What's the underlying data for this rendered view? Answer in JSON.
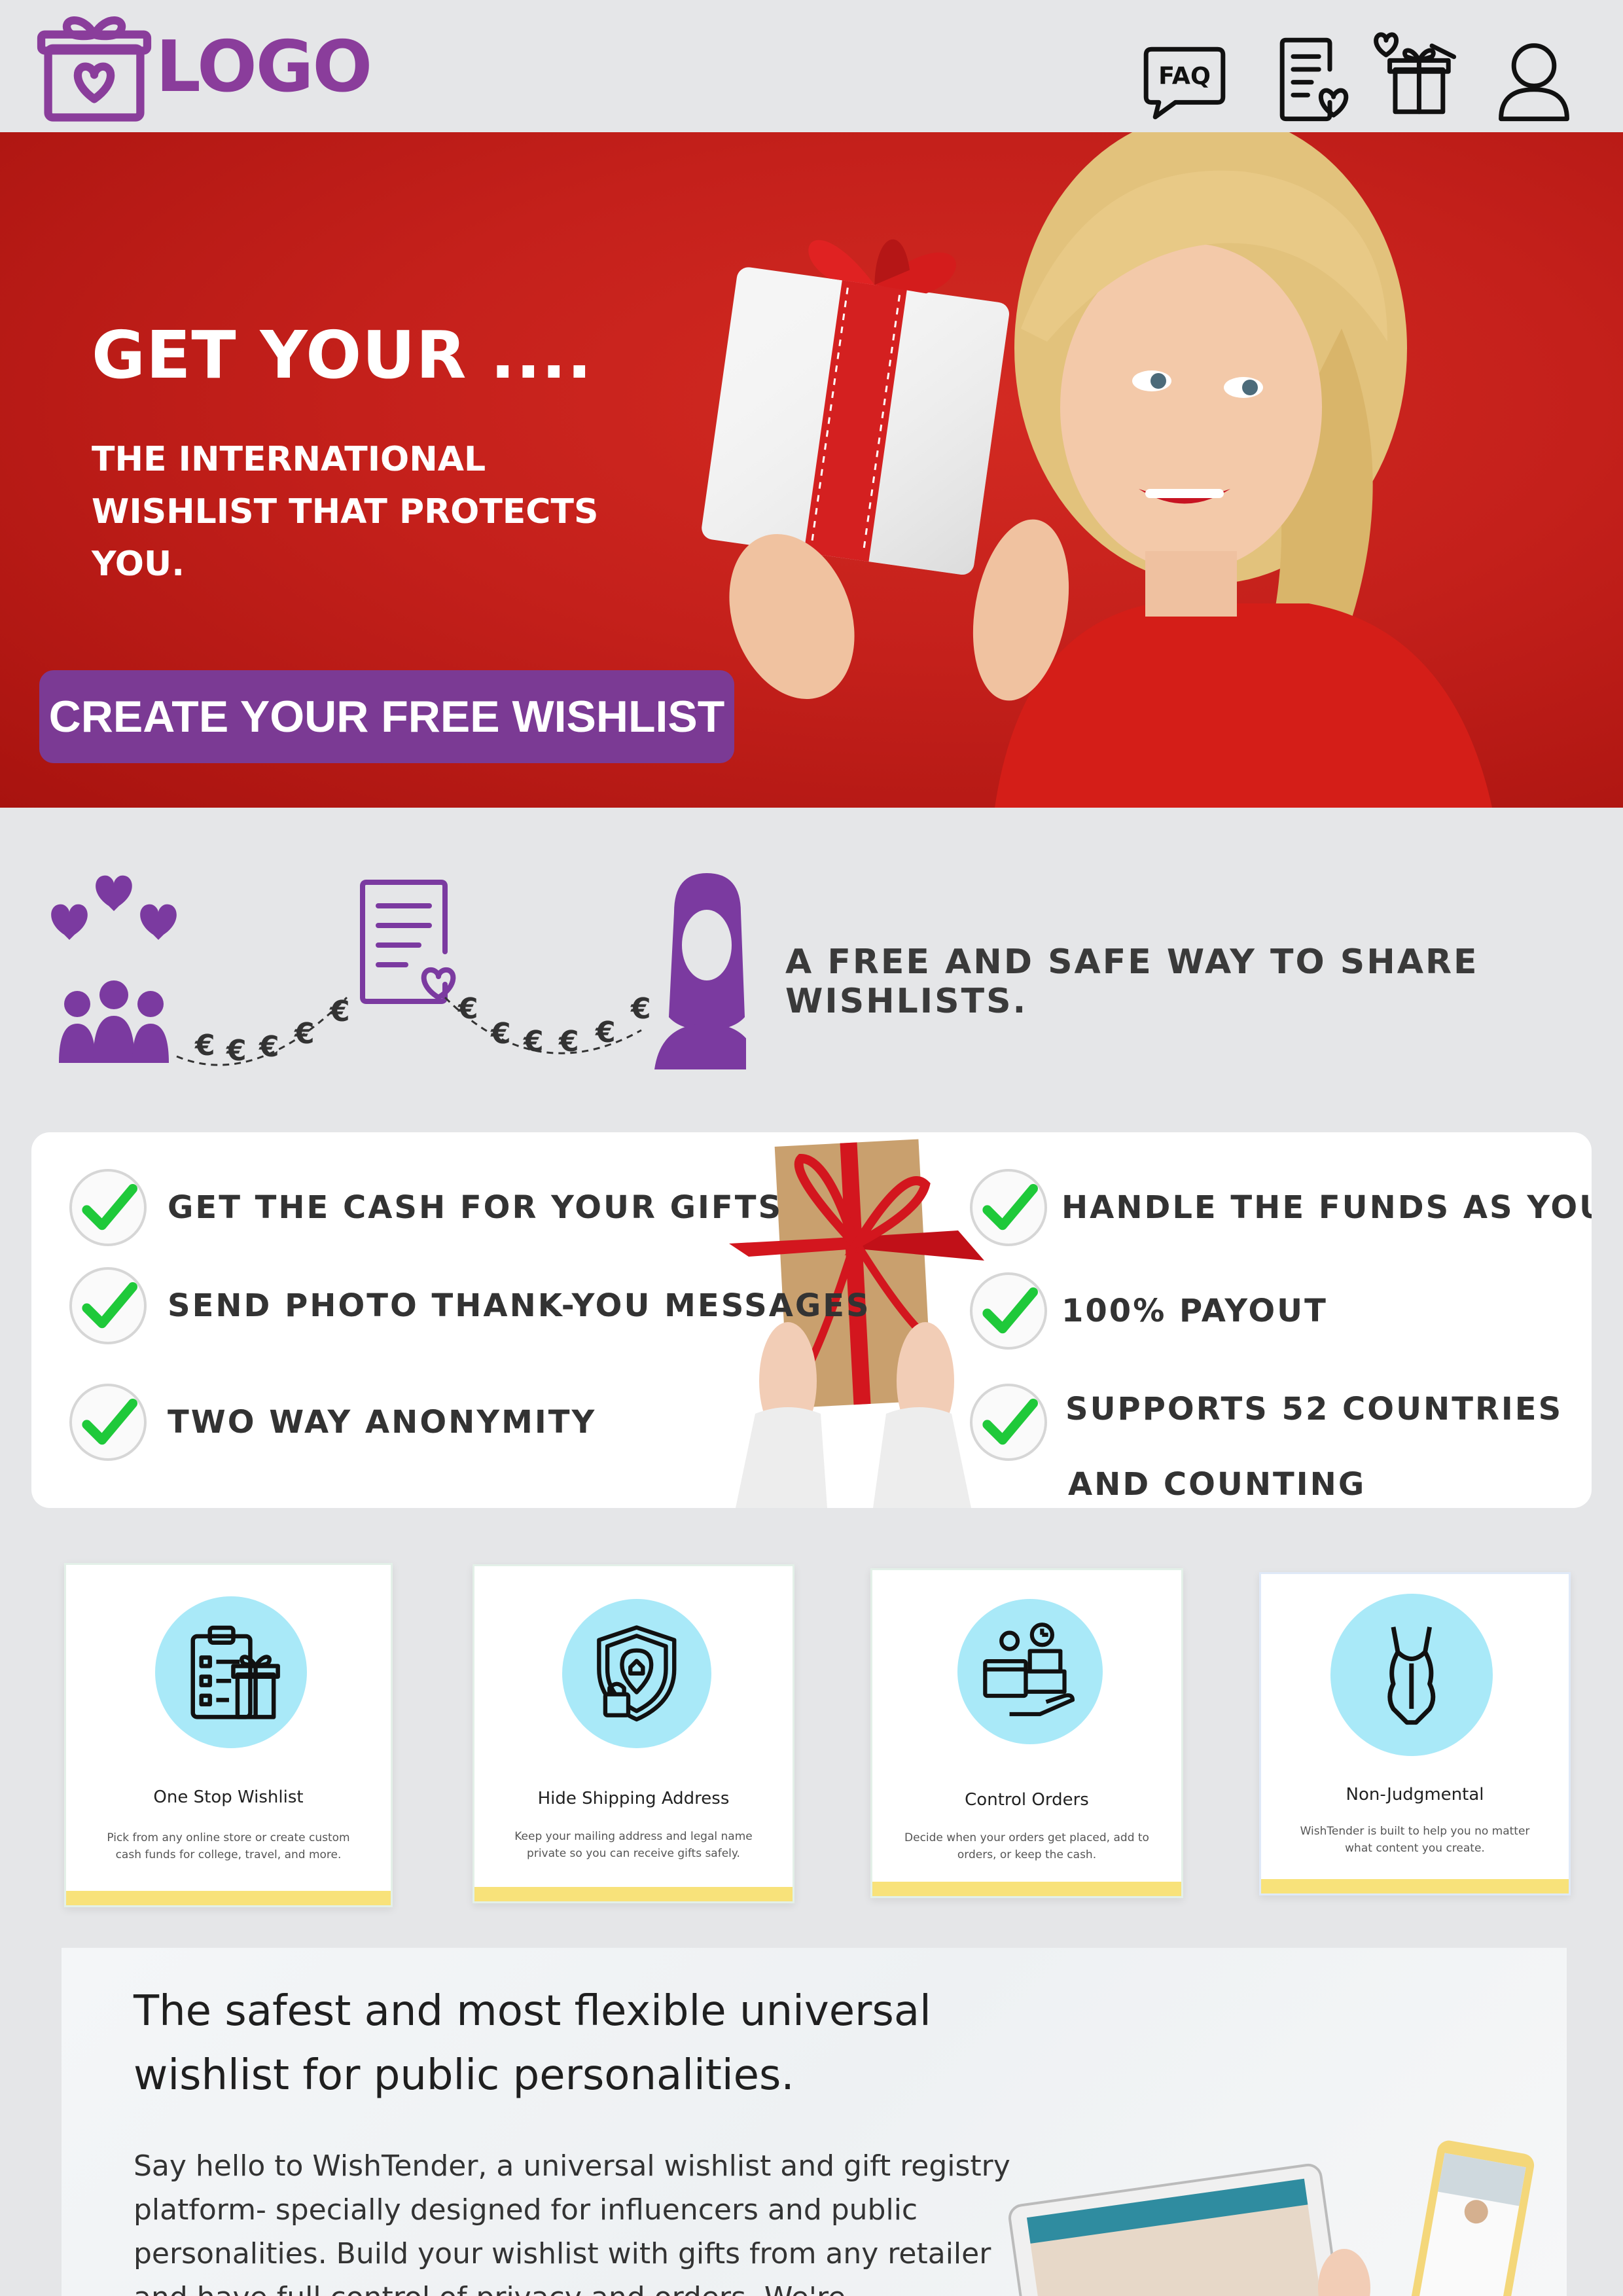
{
  "header": {
    "logo_text": "LOGO",
    "nav": [
      {
        "name": "faq",
        "label": "FAQ"
      },
      {
        "name": "wishlist",
        "label": ""
      },
      {
        "name": "gifts",
        "label": ""
      },
      {
        "name": "account",
        "label": ""
      }
    ]
  },
  "hero": {
    "title": "GET YOUR ....",
    "subtitle": "THE INTERNATIONAL WISHLIST THAT PROTECTS YOU.",
    "cta": "CREATE YOUR FREE WISHLIST"
  },
  "flow": {
    "tagline": "A FREE AND SAFE WAY TO SHARE WISHLISTS.",
    "currency_symbol": "€"
  },
  "features": {
    "left": [
      "GET THE CASH FOR YOUR GIFTS",
      "SEND PHOTO THANK-YOU MESSAGES",
      "TWO WAY ANONYMITY"
    ],
    "right": [
      "HANDLE THE FUNDS AS YOU LIKE",
      "100% PAYOUT",
      "SUPPORTS 52 COUNTRIES",
      "AND COUNTING"
    ]
  },
  "cards": [
    {
      "title": "One Stop Wishlist",
      "desc": "Pick from any online store or create custom cash funds for college, travel, and more.",
      "icon": "clipboard-gift-icon"
    },
    {
      "title": "Hide Shipping Address",
      "desc": "Keep your mailing address and legal name private so you can receive gifts safely.",
      "icon": "shield-lock-icon"
    },
    {
      "title": "Control Orders",
      "desc": "Decide when your orders get placed, add to orders, or keep the cash.",
      "icon": "orders-control-icon"
    },
    {
      "title": "Non-Judgmental",
      "desc": "WishTender is built to help you no matter what content you create.",
      "icon": "lingerie-icon"
    }
  ],
  "bottom": {
    "heading": "The safest and most flexible universal wishlist for public personalities.",
    "body": "Say hello to WishTender, a universal wishlist and gift registry platform- specially designed for influencers and public personalities. Build your wishlist with gifts from any retailer and have full control of privacy and orders. We're"
  },
  "colors": {
    "brand_purple": "#7b3a94",
    "hero_red": "#c4201b",
    "check_green": "#1fc93a",
    "card_circle": "#a9e9f8",
    "card_bar": "#f8e27a"
  }
}
